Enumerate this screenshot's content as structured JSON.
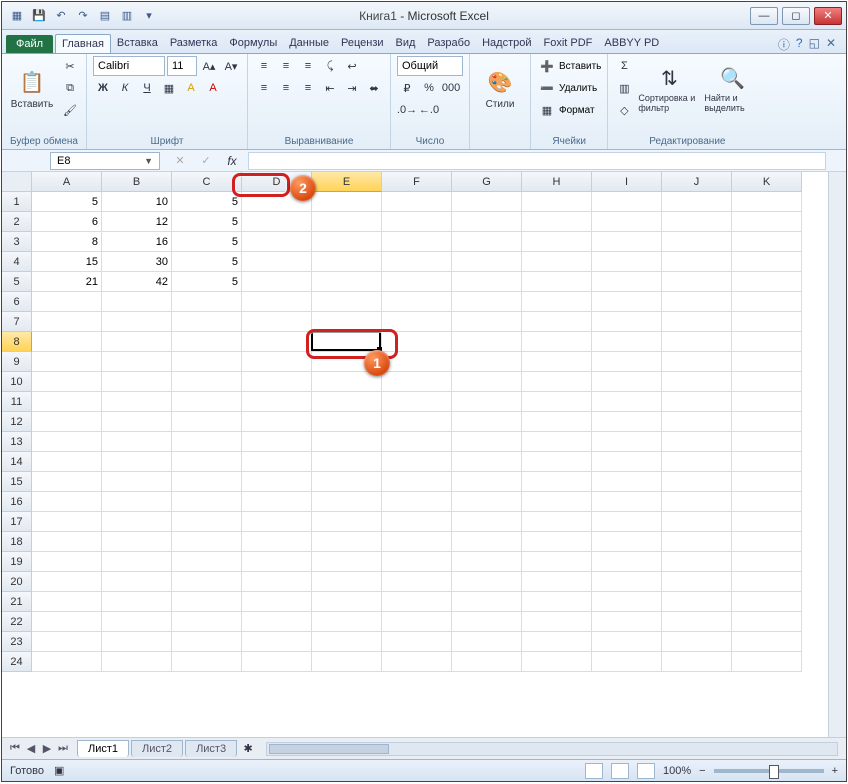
{
  "title": {
    "doc": "Книга1",
    "sep": " - ",
    "app": "Microsoft Excel"
  },
  "tabs": {
    "file": "Файл",
    "list": [
      "Главная",
      "Вставка",
      "Разметка",
      "Формулы",
      "Данные",
      "Рецензи",
      "Вид",
      "Разрабо",
      "Надстрой",
      "Foxit PDF",
      "ABBYY PD"
    ],
    "active": "Главная"
  },
  "ribbon": {
    "clipboard": {
      "paste": "Вставить",
      "label": "Буфер обмена"
    },
    "font": {
      "name": "Calibri",
      "size": "11",
      "label": "Шрифт"
    },
    "align": {
      "label": "Выравнивание"
    },
    "number": {
      "format": "Общий",
      "label": "Число"
    },
    "styles": {
      "btn": "Стили"
    },
    "cells": {
      "insert": "Вставить",
      "delete": "Удалить",
      "format": "Формат",
      "label": "Ячейки"
    },
    "editing": {
      "sort": "Сортировка и фильтр",
      "find": "Найти и выделить",
      "label": "Редактирование"
    }
  },
  "formula": {
    "namebox": "E8",
    "fx": "fx"
  },
  "grid": {
    "cols": [
      "A",
      "B",
      "C",
      "D",
      "E",
      "F",
      "G",
      "H",
      "I",
      "J",
      "K"
    ],
    "active_col": "E",
    "rows": 24,
    "active_row": 8,
    "data": [
      {
        "A": "5",
        "B": "10",
        "C": "5"
      },
      {
        "A": "6",
        "B": "12",
        "C": "5"
      },
      {
        "A": "8",
        "B": "16",
        "C": "5"
      },
      {
        "A": "15",
        "B": "30",
        "C": "5"
      },
      {
        "A": "21",
        "B": "42",
        "C": "5"
      }
    ]
  },
  "callouts": {
    "one": "1",
    "two": "2"
  },
  "sheets": {
    "list": [
      "Лист1",
      "Лист2",
      "Лист3"
    ],
    "active": "Лист1"
  },
  "status": {
    "ready": "Готово",
    "zoom": "100%"
  }
}
